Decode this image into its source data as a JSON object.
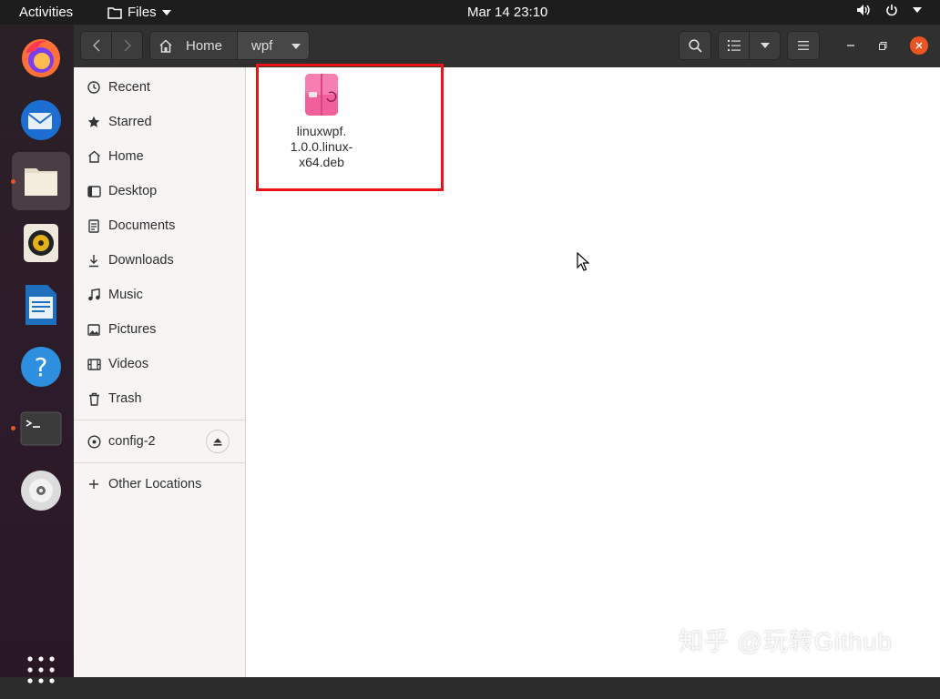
{
  "topbar": {
    "activities": "Activities",
    "app_menu": "Files",
    "clock": "Mar 14  23:10"
  },
  "headerbar": {
    "path": [
      "Home",
      "wpf"
    ]
  },
  "sidebar": {
    "places": [
      {
        "label": "Recent",
        "icon": "clock-icon"
      },
      {
        "label": "Starred",
        "icon": "star-icon"
      },
      {
        "label": "Home",
        "icon": "home-icon"
      },
      {
        "label": "Desktop",
        "icon": "desktop-icon"
      },
      {
        "label": "Documents",
        "icon": "document-icon"
      },
      {
        "label": "Downloads",
        "icon": "download-icon"
      },
      {
        "label": "Music",
        "icon": "music-icon"
      },
      {
        "label": "Pictures",
        "icon": "picture-icon"
      },
      {
        "label": "Videos",
        "icon": "video-icon"
      },
      {
        "label": "Trash",
        "icon": "trash-icon"
      }
    ],
    "devices": [
      {
        "label": "config-2",
        "icon": "disc-icon"
      }
    ],
    "other": {
      "label": "Other Locations"
    }
  },
  "files": [
    {
      "name_lines": [
        "linuxwpf.",
        "1.0.0.linux-",
        "x64.deb"
      ],
      "icon": "deb-package-icon"
    }
  ],
  "watermark": "知乎 @玩转Github",
  "colors": {
    "accent": "#e95420",
    "highlight": "#e8141a",
    "package": "#f0609a"
  }
}
